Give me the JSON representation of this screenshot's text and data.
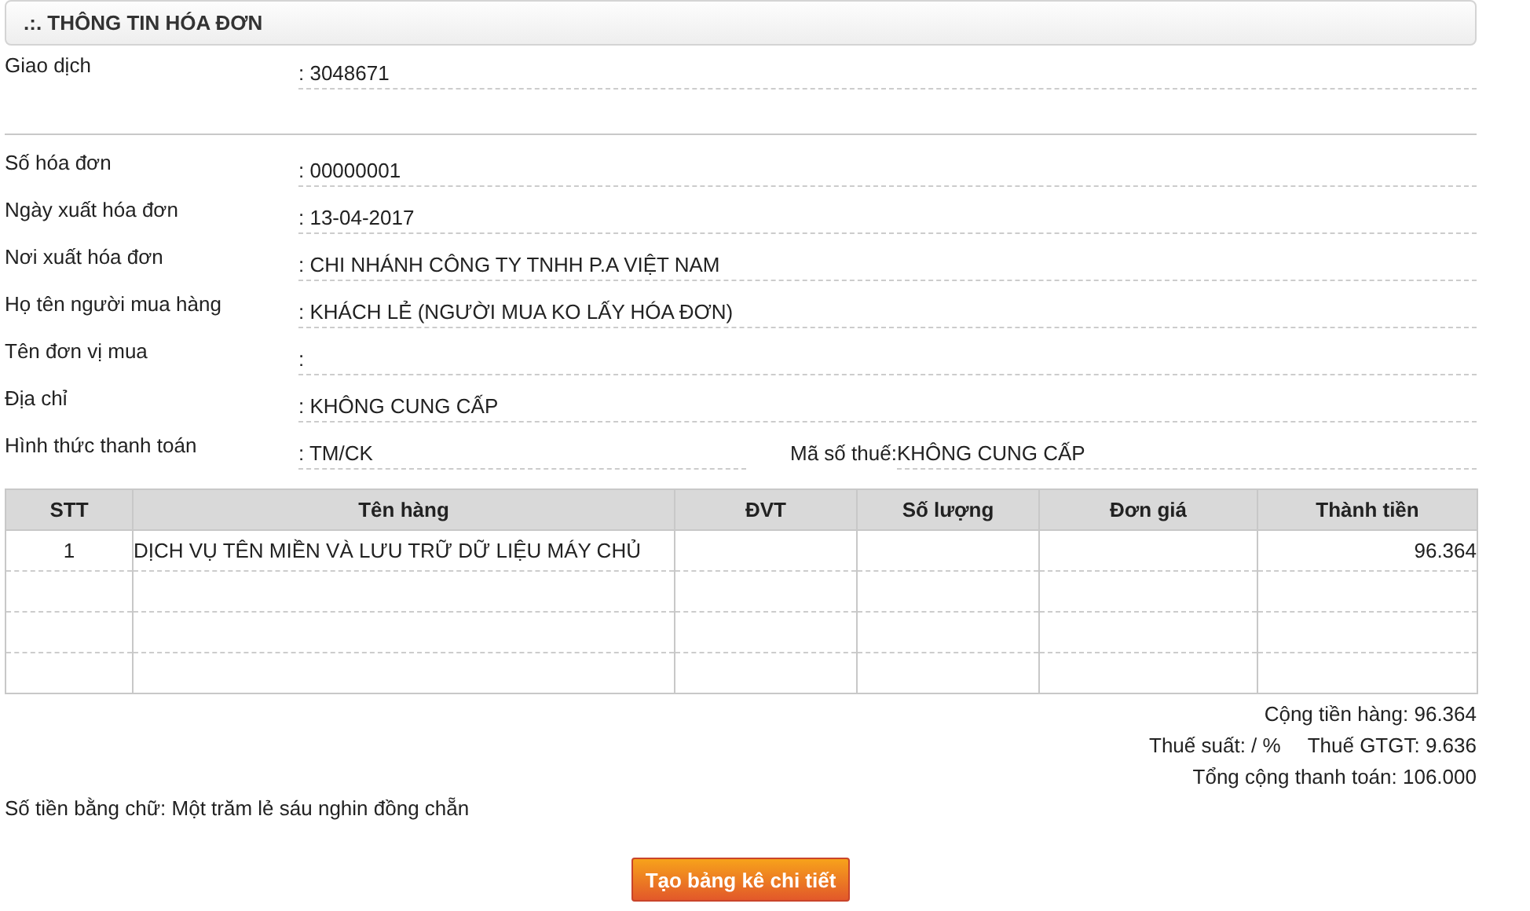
{
  "panel": {
    "title": ".:. THÔNG TIN HÓA ĐƠN"
  },
  "transaction": {
    "label": "Giao dịch",
    "value": ": 3048671"
  },
  "fields": [
    {
      "label": "Số hóa đơn",
      "value": ": 00000001"
    },
    {
      "label": "Ngày xuất hóa đơn",
      "value": ": 13-04-2017"
    },
    {
      "label": "Nơi xuất hóa đơn",
      "value": ": CHI NHÁNH CÔNG TY TNHH P.A VIỆT NAM"
    },
    {
      "label": "Họ tên người mua hàng",
      "value": ": KHÁCH LẺ (NGƯỜI MUA KO LẤY HÓA ĐƠN)"
    },
    {
      "label": "Tên đơn vị mua",
      "value": ":"
    },
    {
      "label": "Địa chỉ",
      "value": ": KHÔNG CUNG CẤP"
    }
  ],
  "payment": {
    "label": "Hình thức thanh toán",
    "value": ": TM/CK",
    "tax_label": "Mã số thuế:",
    "tax_value": "KHÔNG CUNG CẤP"
  },
  "table": {
    "columns": [
      "STT",
      "Tên hàng",
      "ĐVT",
      "Số lượng",
      "Đơn giá",
      "Thành tiền"
    ],
    "rows": [
      {
        "stt": "1",
        "name": "DỊCH VỤ TÊN MIỀN VÀ LƯU TRỮ DỮ LIỆU MÁY CHỦ",
        "amount": "96.364"
      },
      {},
      {},
      {}
    ]
  },
  "totals": {
    "subtotal": "Cộng tiền hàng: 96.364",
    "tax_rate": "Thuế suất: / %",
    "vat": "Thuế GTGT: 9.636",
    "total": "Tổng cộng thanh toán: 106.000"
  },
  "amount_in_words": "Số tiền bằng chữ: Một trăm lẻ sáu nghin đồng chẵn",
  "button": "Tạo bảng kê chi tiết"
}
